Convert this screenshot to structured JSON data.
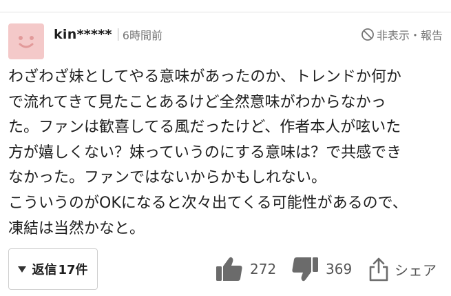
{
  "comment": {
    "user": {
      "name": "kin*****",
      "avatar": "smiling-face-icon"
    },
    "time": "6時間前",
    "report_label": "非表示・報告",
    "body_lines": [
      "わざわざ妹としてやる意味があったのか、トレンドか何か",
      "で流れてきて見たことあるけど全然意味がわからなかっ",
      "た。ファンは歓喜してる風だったけど、作者本人が呟いた",
      "方が嬉しくない？妹っていうのにする意味は？で共感でき",
      "なかった。ファンではないからかもしれない。",
      "こういうのがOKになると次々出てくる可能性があるので、",
      "凍結は当然かなと。"
    ],
    "replies": {
      "label": "返信",
      "count": "17件"
    },
    "reactions": {
      "likes": "272",
      "dislikes": "369",
      "share_label": "シェア"
    }
  },
  "colors": {
    "avatar_bg": "#f4c9c9",
    "avatar_face": "#e29a9a",
    "icon_gray": "#6b6b6b",
    "muted_text": "#757575"
  }
}
